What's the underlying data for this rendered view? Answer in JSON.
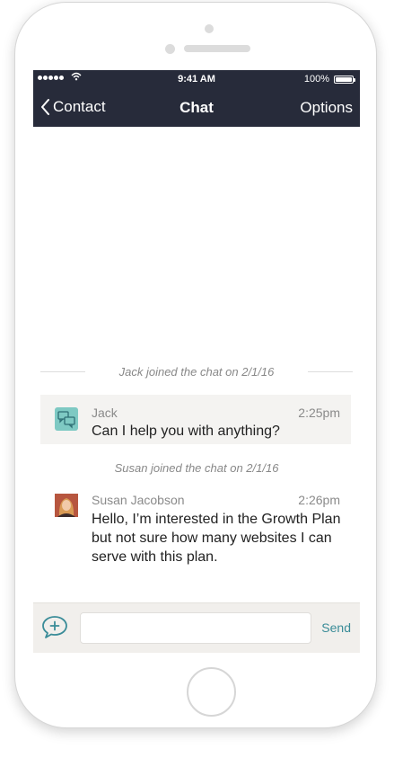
{
  "status_bar": {
    "time": "9:41 AM",
    "battery": "100%"
  },
  "nav": {
    "back_label": "Contact",
    "title": "Chat",
    "options_label": "Options"
  },
  "events": [
    {
      "text": "Jack joined the chat on 2/1/16"
    },
    {
      "text": "Susan joined the chat on 2/1/16"
    }
  ],
  "messages": [
    {
      "sender": "Jack",
      "time": "2:25pm",
      "text": "Can I help you with anything?",
      "avatar": "chat-bubbles-icon"
    },
    {
      "sender": "Susan Jacobson",
      "time": "2:26pm",
      "text": "Hello, I’m interested in the Growth Plan but not sure how many websites I can serve with this plan.",
      "avatar": "user-photo"
    }
  ],
  "compose": {
    "placeholder": "",
    "value": "",
    "send_label": "Send"
  },
  "colors": {
    "header": "#272b3a",
    "accent": "#3a8c98",
    "highlight": "#f4f3f1",
    "compose_bg": "#f1efec"
  }
}
